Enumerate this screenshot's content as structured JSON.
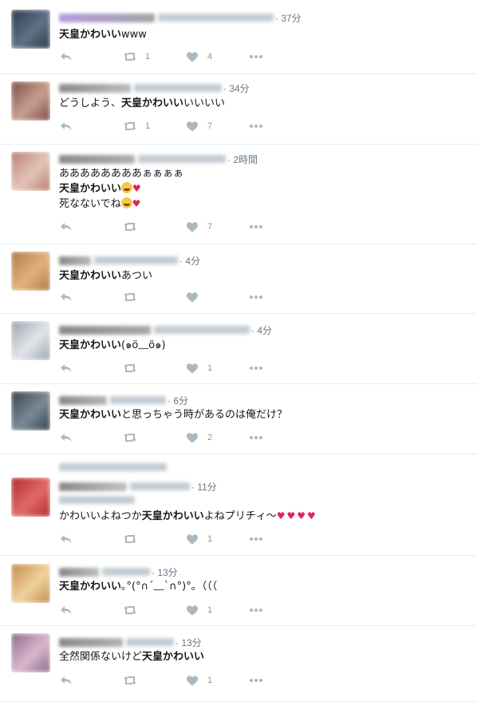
{
  "tweets": [
    {
      "time": "· 37分",
      "text_lines": [
        [
          {
            "t": "天皇かわいい",
            "b": true
          },
          {
            "t": "www",
            "b": false
          }
        ]
      ],
      "replies": "",
      "retweets": "1",
      "likes": "4",
      "avatar_colors": [
        "#2a3a4a",
        "#5f7386"
      ],
      "name_colors": [
        "#b79be0",
        "#a3a3a3"
      ]
    },
    {
      "time": "· 34分",
      "text_lines": [
        [
          {
            "t": "どうしよう、",
            "b": false
          },
          {
            "t": "天皇かわいい",
            "b": true
          },
          {
            "t": "いいいい",
            "b": false
          }
        ]
      ],
      "replies": "",
      "retweets": "1",
      "likes": "7",
      "avatar_colors": [
        "#7d4b4b",
        "#c8a08e"
      ],
      "name_colors": [
        "#8c8c8c",
        "#bdbdbd"
      ]
    },
    {
      "time": "· 2時間",
      "text_lines": [
        [
          {
            "t": "ああああああああぁぁぁぁ",
            "b": false
          }
        ],
        [
          {
            "t": "天皇かわいい",
            "b": true
          },
          {
            "t": "😭💗",
            "b": false,
            "emoji": "face-heart"
          }
        ],
        [
          {
            "t": "死なないでね",
            "b": false
          },
          {
            "t": "😭💗",
            "b": false,
            "emoji": "face-heart"
          }
        ]
      ],
      "replies": "",
      "retweets": "",
      "likes": "7",
      "avatar_colors": [
        "#b97c6e",
        "#e4c5b8"
      ],
      "name_colors": [
        "#8a8a8a",
        "#b0b0b0"
      ]
    },
    {
      "time": "· 4分",
      "text_lines": [
        [
          {
            "t": "天皇かわいい",
            "b": true
          },
          {
            "t": "あつい",
            "b": false
          }
        ]
      ],
      "replies": "",
      "retweets": "",
      "likes": "",
      "avatar_colors": [
        "#b07844",
        "#e0b27c"
      ],
      "name_colors": [
        "#8a8a8a",
        "#b8b8b8"
      ]
    },
    {
      "time": "· 4分",
      "text_lines": [
        [
          {
            "t": "天皇かわいい",
            "b": true
          },
          {
            "t": "(๑ö﹏ö๑)",
            "b": false
          }
        ]
      ],
      "replies": "",
      "retweets": "",
      "likes": "1",
      "avatar_colors": [
        "#9aa3ad",
        "#e2e6ea"
      ],
      "name_colors": [
        "#8a8a8a",
        "#a9a9a9"
      ]
    },
    {
      "time": "· 6分",
      "text_lines": [
        [
          {
            "t": "天皇かわいい",
            "b": true
          },
          {
            "t": "と思っちゃう時があるのは俺だけ？",
            "b": false
          }
        ]
      ],
      "replies": "",
      "retweets": "",
      "likes": "2",
      "avatar_colors": [
        "#34404c",
        "#7b8a97"
      ],
      "name_colors": [
        "#8a8a8a",
        "#b5b5b5"
      ]
    },
    {
      "time": "· 11分",
      "text_lines": [
        [
          {
            "t": "かわいいよねつか",
            "b": false
          },
          {
            "t": "天皇かわいい",
            "b": true
          },
          {
            "t": "よねプリチィ～",
            "b": false
          },
          {
            "t": "💕💕💕💘",
            "b": false,
            "emoji": "hearts"
          }
        ]
      ],
      "replies": "",
      "retweets": "",
      "likes": "1",
      "avatar_colors": [
        "#b02828",
        "#e36a6a"
      ],
      "name_colors": [
        "#8a8a8a",
        "#c0c0c0"
      ]
    },
    {
      "time": "· 13分",
      "text_lines": [
        [
          {
            "t": "天皇かわいい",
            "b": true
          },
          {
            "t": "｡°(°∩´﹏`∩°)°｡（（（",
            "b": false
          }
        ]
      ],
      "replies": "",
      "retweets": "",
      "likes": "1",
      "avatar_colors": [
        "#c48a4a",
        "#f0d29e"
      ],
      "name_colors": [
        "#8a8a8a",
        "#bcbcbc"
      ]
    },
    {
      "time": "· 13分",
      "text_lines": [
        [
          {
            "t": "全然関係ないけど",
            "b": false
          },
          {
            "t": "天皇かわいい",
            "b": true
          }
        ]
      ],
      "replies": "",
      "retweets": "",
      "likes": "1",
      "avatar_colors": [
        "#8d6a86",
        "#d9b7cf"
      ],
      "name_colors": [
        "#8a8a8a",
        "#b3b3b3"
      ]
    }
  ],
  "icons": {
    "reply": "reply-icon",
    "retweet": "retweet-icon",
    "like": "heart-icon",
    "more": "more-icon"
  },
  "colors": {
    "text": "#14171a",
    "meta": "#657786",
    "action": "#aab8c2",
    "divider": "#e6ecf0"
  }
}
